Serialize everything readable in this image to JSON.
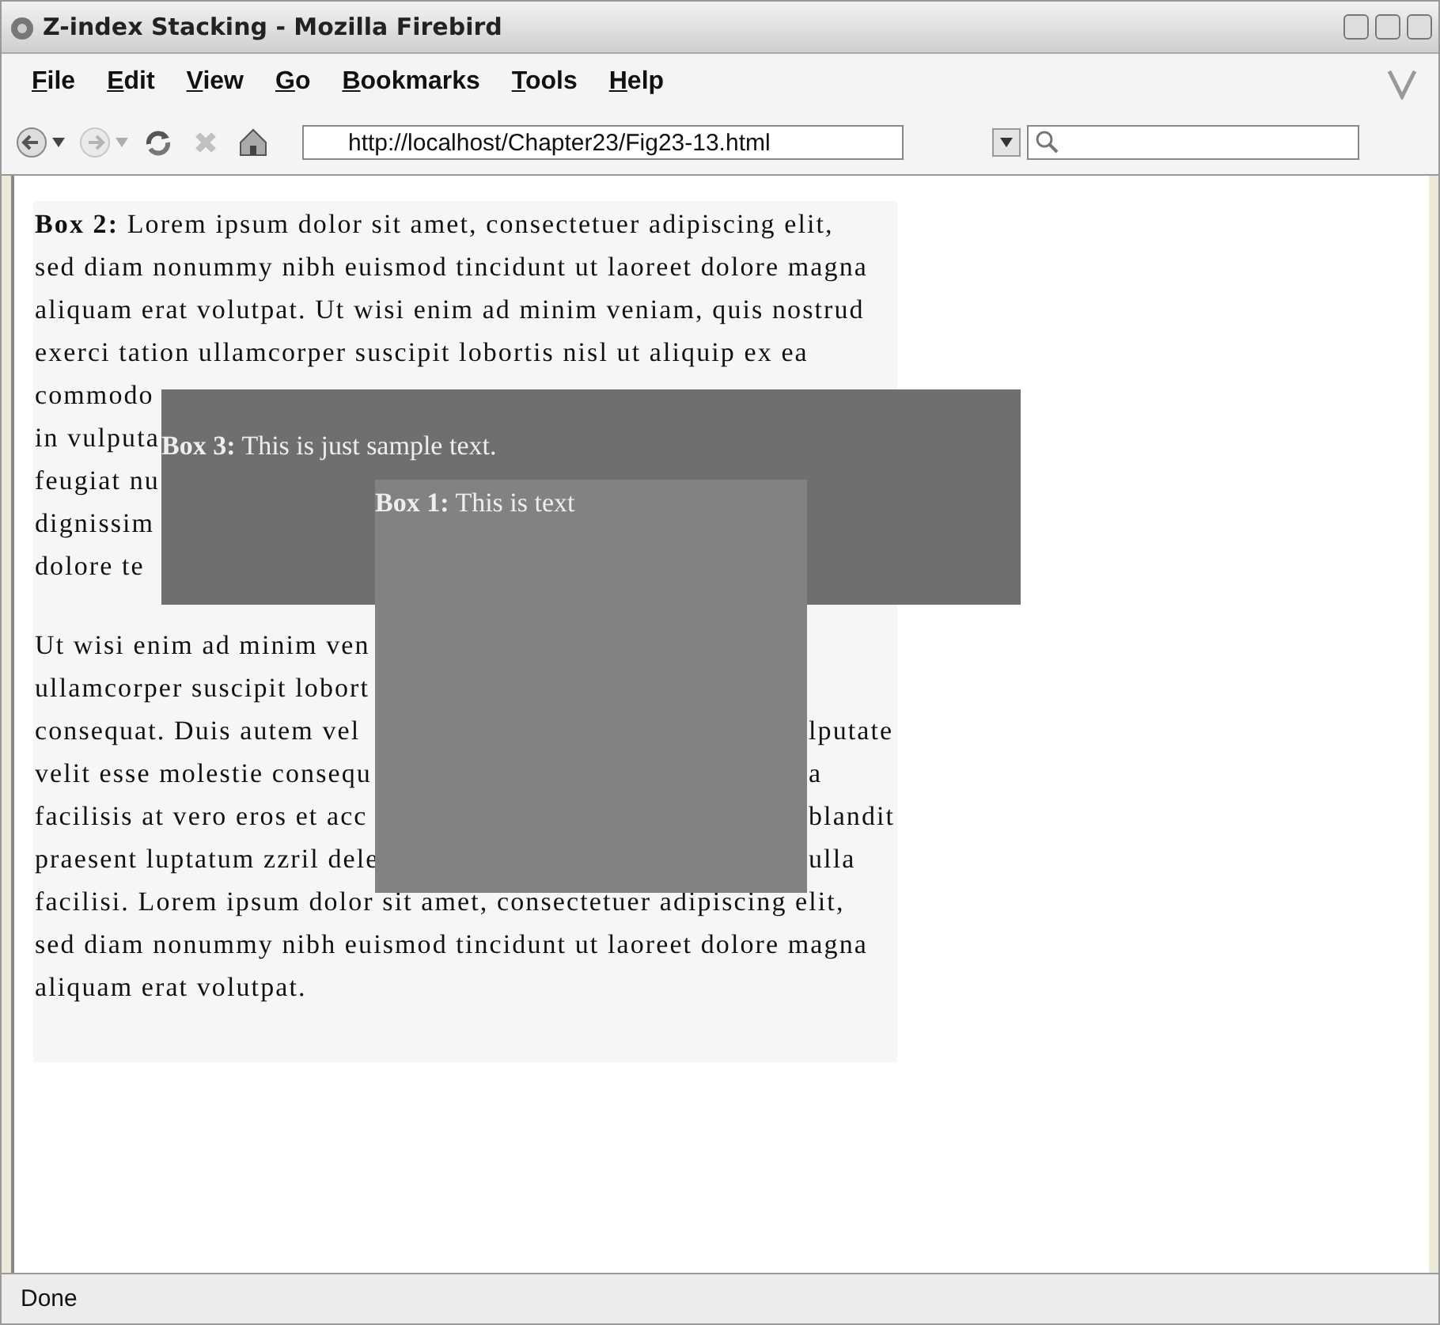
{
  "window": {
    "title": "Z-index Stacking - Mozilla Firebird"
  },
  "menu": [
    "File",
    "Edit",
    "View",
    "Go",
    "Bookmarks",
    "Tools",
    "Help"
  ],
  "toolbar": {
    "buttons": [
      {
        "kind": "back",
        "disabled": false,
        "dropdown": true
      },
      {
        "kind": "forward",
        "disabled": true,
        "dropdown": true
      },
      {
        "kind": "reload",
        "disabled": false,
        "dropdown": false
      },
      {
        "kind": "stop",
        "disabled": true,
        "dropdown": false
      },
      {
        "kind": "home",
        "disabled": false,
        "dropdown": false
      }
    ],
    "address": "http://localhost/Chapter23/Fig23-13.html"
  },
  "page": {
    "box2": {
      "paragraphs": [
        [
          {
            "text": "**Box 2:** Lorem ipsum dolor sit amet, consectetuer adipiscing elit,"
          },
          {
            "text": "sed diam nonummy nibh euismod tincidunt ut laoreet dolore magna"
          },
          {
            "text": "aliquam erat volutpat. Ut wisi enim ad minim veniam, quis nostrud"
          },
          {
            "text": "exerci tation ullamcorper suscipit lobortis nisl ut aliquip ex ea"
          },
          {
            "text": "commodo"
          },
          {
            "text": "in vulputa"
          },
          {
            "text": "feugiat nu"
          },
          {
            "text": "dignissim"
          },
          {
            "text": "dolore te"
          }
        ],
        [
          {
            "text": "Ut wisi enim ad minim ven"
          },
          {
            "text": "ullamcorper suscipit lobort"
          },
          {
            "text": "consequat. Duis autem vel",
            "right": "lputate"
          },
          {
            "text": "velit esse molestie consequ",
            "right": "a"
          },
          {
            "text": "facilisis at vero eros et acc",
            "right": "blandit"
          },
          {
            "text": "praesent luptatum zzril dele",
            "right": "ulla"
          },
          {
            "text": "facilisi. Lorem ipsum dolor sit amet, consectetuer adipiscing elit,"
          },
          {
            "text": "sed diam nonummy nibh euismod tincidunt ut laoreet dolore magna"
          },
          {
            "text": "aliquam erat volutpat."
          }
        ]
      ]
    },
    "box3": {
      "text": "**Box 3:** This is just sample text."
    },
    "box1": {
      "text": "**Box 1:** This is text"
    }
  },
  "status_bar": "Done"
}
